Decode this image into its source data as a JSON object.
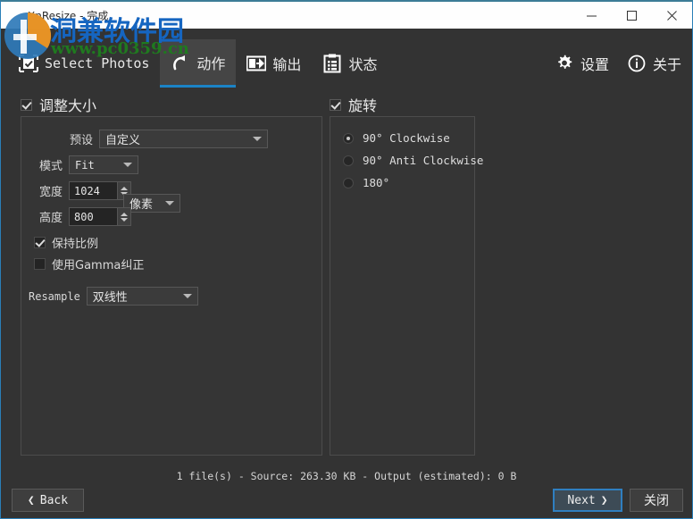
{
  "window": {
    "title": "XnResize - 完成",
    "controls": {
      "minimize": "minimize",
      "maximize": "maximize",
      "close": "close"
    },
    "accent_blue": "#2a7fb8",
    "titlebar_bg": "#ffffff",
    "app_bg": "#333333"
  },
  "watermark": {
    "text": "洞兼软件园",
    "url": "www.pc0359.cn",
    "text_color": "#1565c0",
    "url_color": "#1f7a1f"
  },
  "toolbar": {
    "tabs": [
      {
        "label": "Select Photos",
        "icon": "select-photos-icon",
        "active": false
      },
      {
        "label": "动作",
        "icon": "action-rotate-icon",
        "active": true
      },
      {
        "label": "输出",
        "icon": "output-export-icon",
        "active": false
      },
      {
        "label": "状态",
        "icon": "status-list-icon",
        "active": false
      }
    ],
    "actions": [
      {
        "label": "设置",
        "icon": "gear-icon"
      },
      {
        "label": "关于",
        "icon": "info-icon"
      }
    ],
    "active_tab_underline_color": "#1b83c6"
  },
  "resize_panel": {
    "title": "调整大小",
    "enabled": true,
    "preset": {
      "label": "预设",
      "value": "自定义"
    },
    "mode": {
      "label": "模式",
      "value": "Fit"
    },
    "width": {
      "label": "宽度",
      "value": "1024"
    },
    "height": {
      "label": "高度",
      "value": "800"
    },
    "unit": {
      "value": "像素"
    },
    "keep_ratio": {
      "label": "保持比例",
      "checked": true
    },
    "gamma": {
      "label": "使用Gamma纠正",
      "checked": false
    },
    "resample": {
      "label": "Resample",
      "value": "双线性"
    }
  },
  "rotate_panel": {
    "title": "旋转",
    "enabled": true,
    "options": [
      {
        "label": "90°  Clockwise",
        "selected": true
      },
      {
        "label": "90°  Anti Clockwise",
        "selected": false
      },
      {
        "label": "180°",
        "selected": false
      }
    ]
  },
  "status": {
    "text": "1 file(s) - Source: 263.30 KB - Output (estimated): 0 B"
  },
  "footer": {
    "back": "Back",
    "next": "Next",
    "close": "关闭"
  }
}
